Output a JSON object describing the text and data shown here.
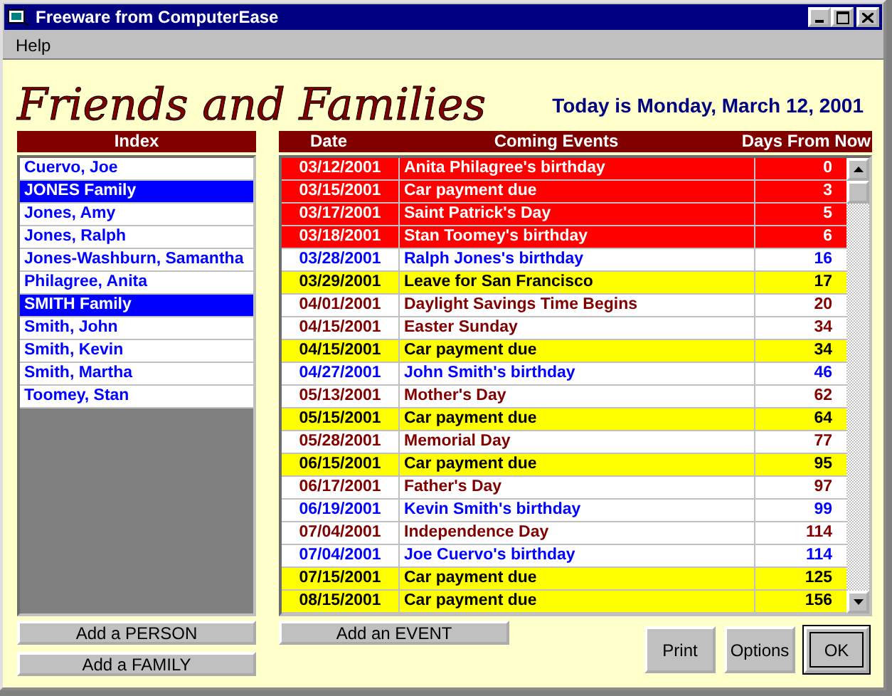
{
  "window": {
    "title": "Freeware from ComputerEase"
  },
  "menu": [
    "Help"
  ],
  "header": {
    "title": "Friends and Families",
    "today": "Today is Monday, March 12, 2001"
  },
  "index": {
    "heading": "Index",
    "items": [
      {
        "label": "Cuervo, Joe",
        "selected": false
      },
      {
        "label": "JONES Family",
        "selected": true
      },
      {
        "label": "Jones, Amy",
        "selected": false
      },
      {
        "label": "Jones, Ralph",
        "selected": false
      },
      {
        "label": "Jones-Washburn, Samantha",
        "selected": false
      },
      {
        "label": "Philagree, Anita",
        "selected": false
      },
      {
        "label": "SMITH Family",
        "selected": true
      },
      {
        "label": "Smith, John",
        "selected": false
      },
      {
        "label": "Smith, Kevin",
        "selected": false
      },
      {
        "label": "Smith, Martha",
        "selected": false
      },
      {
        "label": "Toomey, Stan",
        "selected": false
      }
    ],
    "buttons": [
      "Add a PERSON",
      "Add a FAMILY"
    ]
  },
  "events": {
    "columns": [
      "Date",
      "Coming Events",
      "Days From Now"
    ],
    "rows": [
      {
        "date": "03/12/2001",
        "event": "Anita Philagree's birthday",
        "days": "0",
        "kind": "soon"
      },
      {
        "date": "03/15/2001",
        "event": "Car payment due",
        "days": "3",
        "kind": "soon"
      },
      {
        "date": "03/17/2001",
        "event": "Saint Patrick's Day",
        "days": "5",
        "kind": "soon"
      },
      {
        "date": "03/18/2001",
        "event": "Stan Toomey's birthday",
        "days": "6",
        "kind": "soon"
      },
      {
        "date": "03/28/2001",
        "event": "Ralph Jones's birthday",
        "days": "16",
        "kind": "birthday"
      },
      {
        "date": "03/29/2001",
        "event": "Leave for San Francisco",
        "days": "17",
        "kind": "reminder"
      },
      {
        "date": "04/01/2001",
        "event": "Daylight Savings Time Begins",
        "days": "20",
        "kind": "holiday"
      },
      {
        "date": "04/15/2001",
        "event": "Easter Sunday",
        "days": "34",
        "kind": "holiday"
      },
      {
        "date": "04/15/2001",
        "event": "Car payment due",
        "days": "34",
        "kind": "reminder"
      },
      {
        "date": "04/27/2001",
        "event": "John Smith's birthday",
        "days": "46",
        "kind": "birthday"
      },
      {
        "date": "05/13/2001",
        "event": "Mother's Day",
        "days": "62",
        "kind": "holiday"
      },
      {
        "date": "05/15/2001",
        "event": "Car payment due",
        "days": "64",
        "kind": "reminder"
      },
      {
        "date": "05/28/2001",
        "event": "Memorial Day",
        "days": "77",
        "kind": "holiday"
      },
      {
        "date": "06/15/2001",
        "event": "Car payment due",
        "days": "95",
        "kind": "reminder"
      },
      {
        "date": "06/17/2001",
        "event": "Father's Day",
        "days": "97",
        "kind": "holiday"
      },
      {
        "date": "06/19/2001",
        "event": "Kevin Smith's birthday",
        "days": "99",
        "kind": "birthday"
      },
      {
        "date": "07/04/2001",
        "event": "Independence Day",
        "days": "114",
        "kind": "holiday"
      },
      {
        "date": "07/04/2001",
        "event": "Joe Cuervo's birthday",
        "days": "114",
        "kind": "birthday"
      },
      {
        "date": "07/15/2001",
        "event": "Car payment due",
        "days": "125",
        "kind": "reminder"
      },
      {
        "date": "08/15/2001",
        "event": "Car payment due",
        "days": "156",
        "kind": "reminder"
      }
    ],
    "button": "Add an EVENT"
  },
  "dialog_buttons": [
    {
      "label": "Print",
      "default": false
    },
    {
      "label": "Options",
      "default": false
    },
    {
      "label": "OK",
      "default": true
    }
  ]
}
